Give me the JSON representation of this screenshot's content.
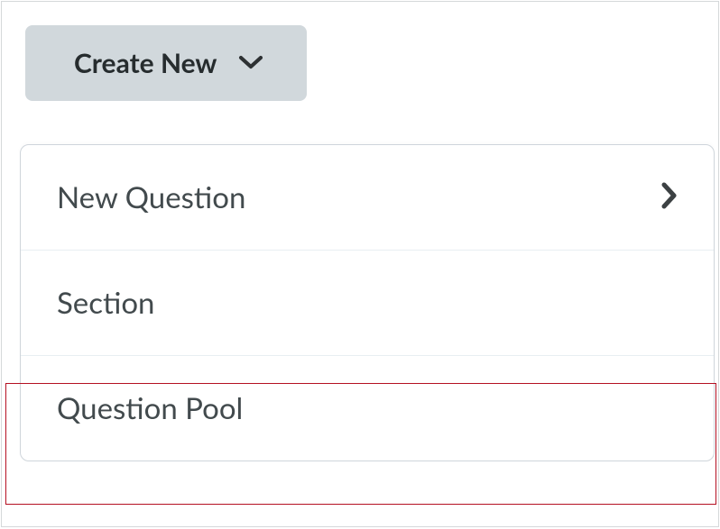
{
  "button": {
    "create_new_label": "Create New"
  },
  "menu": {
    "items": [
      {
        "label": "New Question",
        "has_submenu": true
      },
      {
        "label": "Section",
        "has_submenu": false
      },
      {
        "label": "Question Pool",
        "has_submenu": false
      }
    ]
  },
  "highlight": {
    "color": "#b51122"
  },
  "bg_fragment": "e\n:"
}
